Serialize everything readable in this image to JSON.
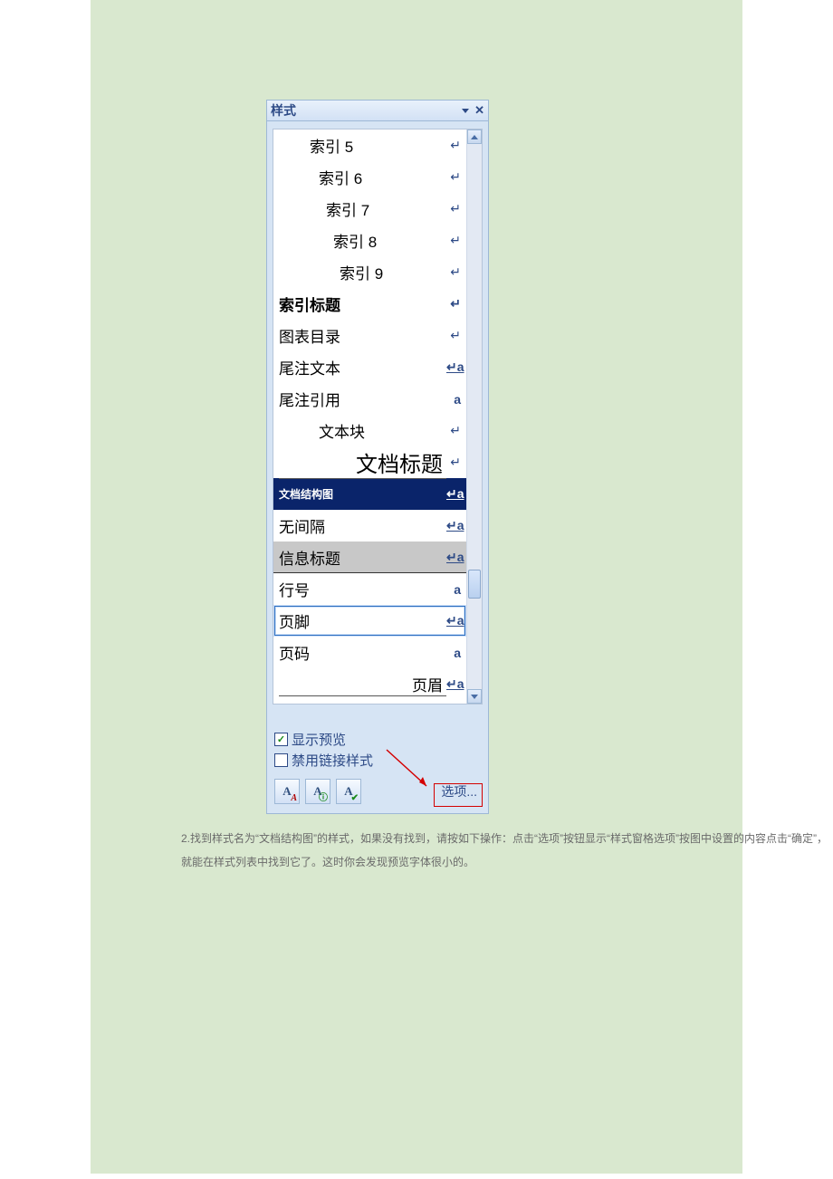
{
  "panel": {
    "title": "样式",
    "styles": [
      {
        "label": "索引 5",
        "mark": "ret",
        "indent": 1
      },
      {
        "label": "索引 6",
        "mark": "ret",
        "indent": 2
      },
      {
        "label": "索引 7",
        "mark": "ret",
        "indent": 3
      },
      {
        "label": "索引 8",
        "mark": "ret",
        "indent": 4
      },
      {
        "label": "索引 9",
        "mark": "ret",
        "indent": 5
      },
      {
        "label": "索引标题",
        "mark": "ret",
        "bold": true
      },
      {
        "label": "图表目录",
        "mark": "ret"
      },
      {
        "label": "尾注文本",
        "mark": "pa"
      },
      {
        "label": "尾注引用",
        "mark": "a"
      },
      {
        "label": "文本块",
        "mark": "ret",
        "indent": 2
      },
      {
        "label": "文档标题",
        "mark": "ret",
        "big": true,
        "ralign": true,
        "underline": true
      },
      {
        "label": "文档结构图",
        "mark": "pa",
        "selected": true
      },
      {
        "label": "无间隔",
        "mark": "pa"
      },
      {
        "label": "信息标题",
        "mark": "pa",
        "infohead": true
      },
      {
        "label": "行号",
        "mark": "a"
      },
      {
        "label": "页脚",
        "mark": "pa",
        "hover": true
      },
      {
        "label": "页码",
        "mark": "a"
      },
      {
        "label": "页眉",
        "mark": "pa",
        "ralign": true,
        "underline": true
      }
    ],
    "footer": {
      "show_preview": {
        "label": "显示预览",
        "checked": true
      },
      "disable_linked": {
        "label": "禁用链接样式",
        "checked": false
      },
      "options_label": "选项..."
    }
  },
  "body_text": "2.找到样式名为“文档结构图”的样式，如果没有找到，请按如下操作：点击“选项”按钮显示“样式窗格选项”按图中设置的内容点击“确定”，就能在样式列表中找到它了。这时你会发现预览字体很小的。"
}
